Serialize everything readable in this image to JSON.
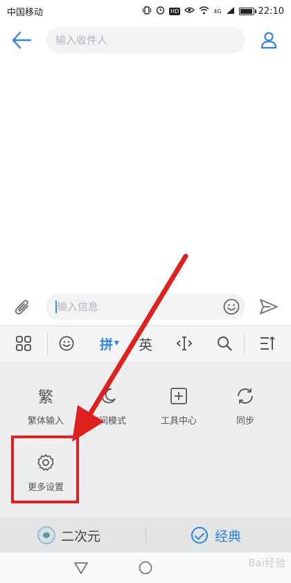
{
  "status_bar": {
    "carrier": "中国移动",
    "icons": [
      "vibrate-icon",
      "alarm-icon",
      "hd-icon",
      "eye-icon",
      "wifi-icon",
      "signal-icon",
      "battery-icon"
    ],
    "hd_text": "HD",
    "network_text": "4G",
    "battery_level": 0.85,
    "time": "22:10"
  },
  "header": {
    "recipient_placeholder": "输入收件人"
  },
  "compose": {
    "message_placeholder": "输入信息"
  },
  "keyboard": {
    "toolbar": {
      "pinyin_label": "拼",
      "english_label": "英"
    },
    "panel": {
      "items": [
        {
          "glyph": "繁",
          "label": "繁体输入"
        },
        {
          "glyph": "",
          "label": "夜间模式"
        },
        {
          "glyph": "",
          "label": "工具中心"
        },
        {
          "glyph": "",
          "label": "同步"
        },
        {
          "glyph": "",
          "label": "更多设置"
        }
      ]
    },
    "skins": {
      "anime_label": "二次元",
      "classic_label": "经典"
    }
  },
  "watermark": "Bai经验",
  "colors": {
    "accent": "#2b84e8",
    "highlight": "#e01f1f"
  }
}
